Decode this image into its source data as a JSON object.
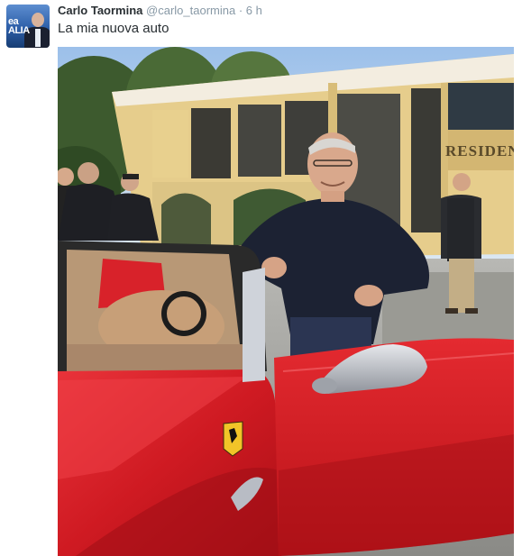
{
  "tweet": {
    "display_name": "Carlo Taormina",
    "handle": "@carlo_taormina",
    "separator": "·",
    "time": "6 h",
    "text": "La mia nuova auto"
  },
  "avatar": {
    "overlay_text": "ea\nALIA"
  },
  "photo": {
    "sign_text": "RESIDEN",
    "colors": {
      "sky": "#8fb6e0",
      "building": "#e9d49a",
      "car_red": "#d81e24",
      "interior_tan": "#c9a27a",
      "sweater": "#1c2233",
      "mirror": "#b9bcc3"
    }
  }
}
